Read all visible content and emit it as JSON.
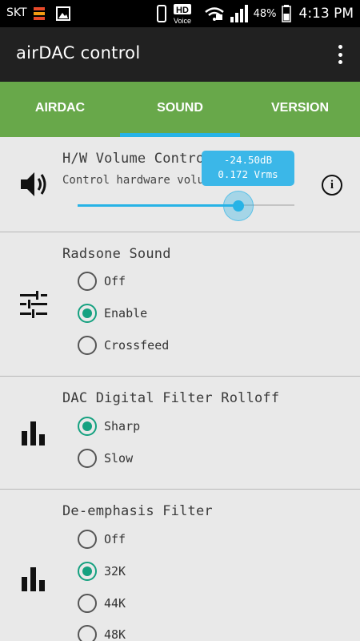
{
  "status_bar": {
    "carrier": "SKT",
    "hd_label": "HD",
    "voice_label": "Voice",
    "battery": "48%",
    "time": "4:13 PM"
  },
  "app_bar": {
    "title": "airDAC control"
  },
  "tabs": [
    {
      "label": "AIRDAC",
      "active": false
    },
    {
      "label": "SOUND",
      "active": true
    },
    {
      "label": "VERSION",
      "active": false
    }
  ],
  "volume": {
    "title": "H/W Volume Control",
    "subtitle": "Control hardware volume",
    "tooltip_db": "-24.50dB",
    "tooltip_vrms": "0.172 Vrms",
    "level": 0.74
  },
  "radsone": {
    "title": "Radsone Sound",
    "options": [
      {
        "label": "Off",
        "checked": false
      },
      {
        "label": "Enable",
        "checked": true
      },
      {
        "label": "Crossfeed",
        "checked": false
      }
    ]
  },
  "rolloff": {
    "title": "DAC Digital Filter Rolloff",
    "options": [
      {
        "label": "Sharp",
        "checked": true
      },
      {
        "label": "Slow",
        "checked": false
      }
    ]
  },
  "deemphasis": {
    "title": "De-emphasis Filter",
    "options": [
      {
        "label": "Off",
        "checked": false
      },
      {
        "label": "32K",
        "checked": true
      },
      {
        "label": "44K",
        "checked": false
      },
      {
        "label": "48K",
        "checked": false
      }
    ]
  },
  "colors": {
    "tab_bar": "#68a84a",
    "accent": "#27b3e6",
    "radio_checked": "#15a180",
    "app_bar": "#212121"
  }
}
